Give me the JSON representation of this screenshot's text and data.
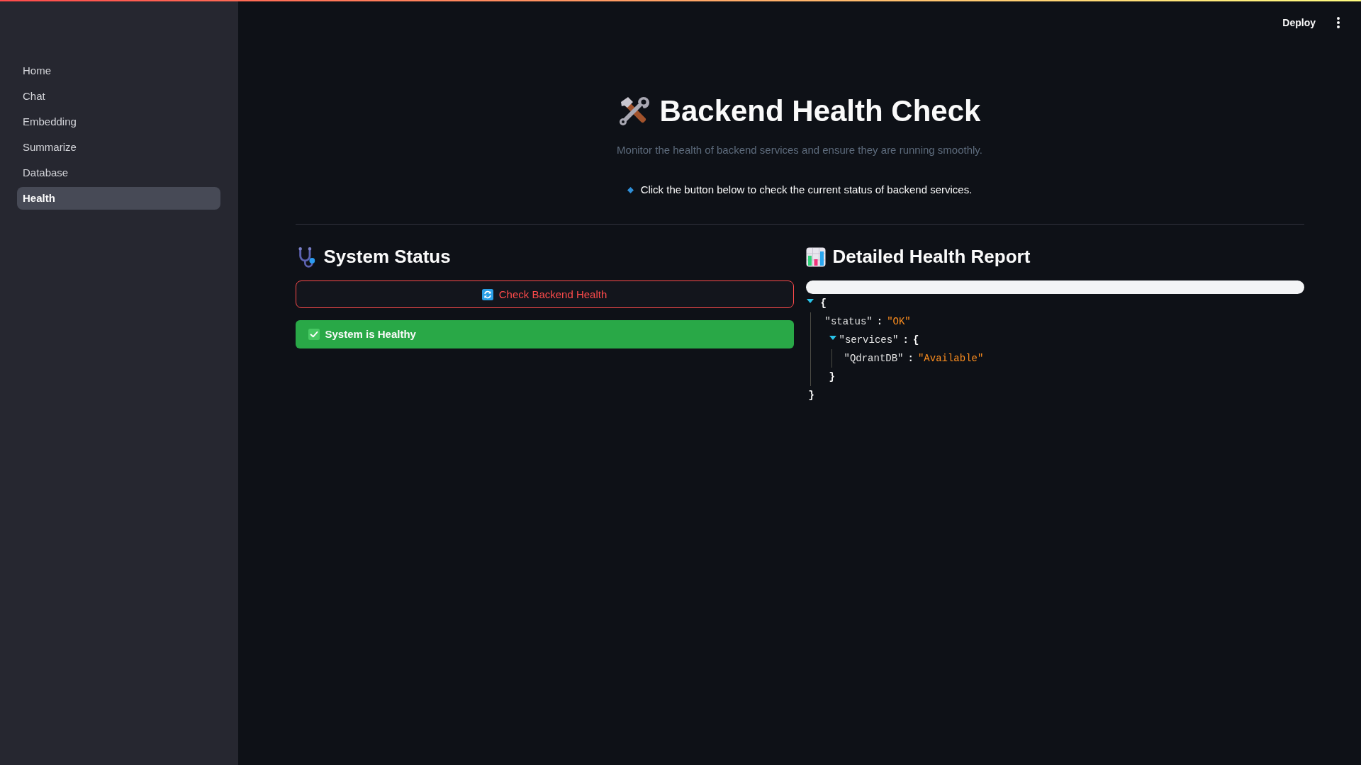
{
  "top_bar": {
    "deploy_button": "Deploy"
  },
  "sidebar": {
    "items": [
      {
        "label": "Home",
        "selected": false
      },
      {
        "label": "Chat",
        "selected": false
      },
      {
        "label": "Embedding",
        "selected": false
      },
      {
        "label": "Summarize",
        "selected": false
      },
      {
        "label": "Database",
        "selected": false
      },
      {
        "label": "Health",
        "selected": true
      }
    ]
  },
  "page": {
    "title": "Backend Health Check",
    "subtitle": "Monitor the health of backend services and ensure they are running smoothly.",
    "bullet": "Click the button below to check the current status of backend services."
  },
  "system_status": {
    "heading": "System Status",
    "button": "Check Backend Health",
    "alert": {
      "kind": "success",
      "text": "System is Healthy"
    }
  },
  "health_report": {
    "heading": "Detailed Health Report",
    "json": {
      "kind": "object",
      "open": "{",
      "close": "}",
      "expanded": true,
      "children": [
        {
          "kind": "string",
          "key": "\"status\"",
          "colon": ":",
          "value": "\"OK\""
        },
        {
          "kind": "object",
          "key": "\"services\"",
          "colon": ":",
          "open": "{",
          "close": "}",
          "expanded": true,
          "children": [
            {
              "kind": "string",
              "key": "\"QdrantDB\"",
              "colon": ":",
              "value": "\"Available\""
            }
          ]
        }
      ]
    }
  }
}
